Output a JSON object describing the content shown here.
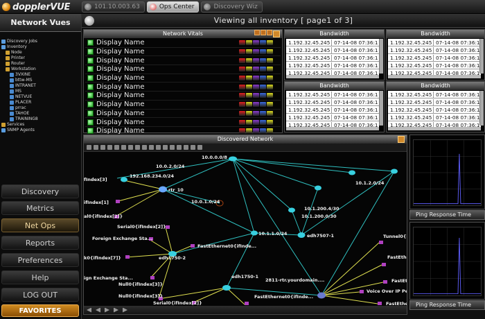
{
  "app": {
    "brand": "dopplerVUE"
  },
  "tabs": [
    {
      "label": "101.10.003.63",
      "active": false
    },
    {
      "label": "Ops Center",
      "active": true
    },
    {
      "label": "Discovery Wiz",
      "active": false
    }
  ],
  "sidebar": {
    "header": "Network Vues",
    "tree": [
      {
        "label": "Discovery Jobs",
        "level": 0,
        "color": "#5a9de0"
      },
      {
        "label": "Inventory",
        "level": 0,
        "color": "#5a9de0"
      },
      {
        "label": "Node",
        "level": 1,
        "color": "#d0a030"
      },
      {
        "label": "Printer",
        "level": 1,
        "color": "#d0a030"
      },
      {
        "label": "Router",
        "level": 1,
        "color": "#d0a030"
      },
      {
        "label": "Workstation",
        "level": 1,
        "color": "#d0a030"
      },
      {
        "label": "3VXINE",
        "level": 2,
        "color": "#4a8ad0"
      },
      {
        "label": "bttw-MS",
        "level": 2,
        "color": "#4a8ad0"
      },
      {
        "label": "INTRANET",
        "level": 2,
        "color": "#4a8ad0"
      },
      {
        "label": "MS",
        "level": 2,
        "color": "#4a8ad0"
      },
      {
        "label": "NETVUE",
        "level": 2,
        "color": "#4a8ad0"
      },
      {
        "label": "PLACER",
        "level": 2,
        "color": "#4a8ad0"
      },
      {
        "label": "prrac",
        "level": 2,
        "color": "#4a8ad0"
      },
      {
        "label": "TAHOE",
        "level": 2,
        "color": "#4a8ad0"
      },
      {
        "label": "TRAINING8",
        "level": 2,
        "color": "#4a8ad0"
      },
      {
        "label": "Services",
        "level": 0,
        "color": "#d0a030"
      },
      {
        "label": "SNMP Agents",
        "level": 0,
        "color": "#5a9de0"
      }
    ],
    "nav": [
      "Discovery",
      "Metrics",
      "Net Ops",
      "Reports",
      "Preferences",
      "Help",
      "LOG OUT"
    ],
    "nav_active": "Net Ops",
    "favorites": "FAVORITES"
  },
  "view_title": "Viewing all inventory [ page1 of 3]",
  "vitals": {
    "title": "Network Vitals",
    "rows": [
      "Display Name",
      "Display Name",
      "Display Name",
      "Display Name",
      "Display Name",
      "Display Name",
      "Display Name",
      "Display Name",
      "Display Name",
      "Display Name",
      "Display Name"
    ],
    "bar_colors": [
      "#e02020",
      "#e0e020",
      "#8a3ad0",
      "#3a6ae0",
      "#e0e020"
    ]
  },
  "bandwidth": {
    "panels": [
      {
        "title": "Bandwidth",
        "rows": [
          [
            "1.192.32.45.245",
            "07-14-08 07:36:14"
          ],
          [
            "1.192.32.45.245",
            "07-14-08 07:36:14"
          ],
          [
            "1.192.32.45.245",
            "07-14-08 07:36:14"
          ],
          [
            "1.192.32.45.245",
            "07-14-08 07:36:14"
          ],
          [
            "1.192.32.45.245",
            "07-14-08 07:36:14"
          ]
        ]
      },
      {
        "title": "Bandwidth",
        "rows": [
          [
            "1.192.32.45.245",
            "07-14-08 07:36:14"
          ],
          [
            "1.192.32.45.245",
            "07-14-08 07:36:14"
          ],
          [
            "1.192.32.45.245",
            "07-14-08 07:36:14"
          ],
          [
            "1.192.32.45.245",
            "07-14-08 07:36:14"
          ],
          [
            "1.192.32.45.245",
            "07-14-08 07:36:14"
          ]
        ]
      },
      {
        "title": "Bandwidth",
        "rows": [
          [
            "1.192.32.45.245",
            "07-14-08 07:36:14"
          ],
          [
            "1.192.32.45.245",
            "07-14-08 07:36:14"
          ],
          [
            "1.192.32.45.245",
            "07-14-08 07:36:14"
          ],
          [
            "1.192.32.45.245",
            "07-14-08 07:36:14"
          ],
          [
            "1.192.32.45.245",
            "07-14-08 07:36:14"
          ]
        ]
      },
      {
        "title": "Bandwidth",
        "rows": [
          [
            "1.192.32.45.245",
            "07-14-08 07:36:14"
          ],
          [
            "1.192.32.45.245",
            "07-14-08 07:36:14"
          ],
          [
            "1.192.32.45.245",
            "07-14-08 07:36:14"
          ],
          [
            "1.192.32.45.245",
            "07-14-08 07:36:14"
          ],
          [
            "1.192.32.45.245",
            "07-14-08 07:36:14"
          ]
        ]
      }
    ]
  },
  "network": {
    "title": "Discovered Network",
    "labels": [
      "10.0.0.0/8",
      "10.0.2.0/24",
      "192.168.234.0/24",
      "rtr_10",
      "fIndex[3]",
      "ifIndex[1]",
      "al0{ifIndex[2]}",
      "10.0.1.0/24",
      "10.1.200.4/30",
      "10.1.2.0/24",
      "10.1.200.0/30",
      "edh7507-1",
      "10.1.1.0/24",
      "Serial0{ifIndex[2]}",
      "Foreign Exchange Sta...",
      "FastEthernet0{ifInde...",
      "k0{ifIndex[7]}",
      "edh1750-2",
      "ign Exchange Sta...",
      "Null0{ifIndex[3]}",
      "edh1750-1",
      "2811-rtr.yourdomain....",
      "Null0{ifIndex[3]}",
      "Serial0{ifIndex[2]}",
      "FastEthernet0{ifInde...",
      "Tunnel0{if",
      "FastEther",
      "FastEther",
      "Voice Over IP Pee",
      "FastEther"
    ]
  },
  "ping": {
    "label": "Ping Response Time"
  }
}
